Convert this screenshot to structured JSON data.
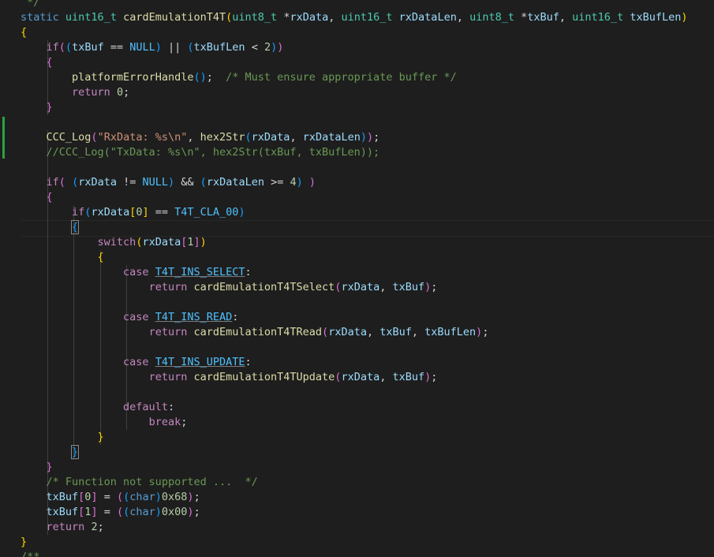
{
  "editor": {
    "language": "c",
    "lines": [
      [
        [
          "k-com",
          " */"
        ]
      ],
      [
        [
          "k-kw",
          "static"
        ],
        [
          "k-pun",
          " "
        ],
        [
          "k-typ",
          "uint16_t"
        ],
        [
          "k-pun",
          " "
        ],
        [
          "k-fn",
          "cardEmulationT4T"
        ],
        [
          "k-b1",
          "("
        ],
        [
          "k-typ",
          "uint8_t"
        ],
        [
          "k-pun",
          " *"
        ],
        [
          "k-var",
          "rxData"
        ],
        [
          "k-pun",
          ", "
        ],
        [
          "k-typ",
          "uint16_t"
        ],
        [
          "k-pun",
          " "
        ],
        [
          "k-var",
          "rxDataLen"
        ],
        [
          "k-pun",
          ", "
        ],
        [
          "k-typ",
          "uint8_t"
        ],
        [
          "k-pun",
          " *"
        ],
        [
          "k-var",
          "txBuf"
        ],
        [
          "k-pun",
          ", "
        ],
        [
          "k-typ",
          "uint16_t"
        ],
        [
          "k-pun",
          " "
        ],
        [
          "k-var",
          "txBufLen"
        ],
        [
          "k-b1",
          ")"
        ]
      ],
      [
        [
          "k-b1",
          "{"
        ]
      ],
      [
        [
          "k-pun",
          "    "
        ],
        [
          "k-ctl",
          "if"
        ],
        [
          "k-b2",
          "("
        ],
        [
          "k-b3",
          "("
        ],
        [
          "k-var",
          "txBuf"
        ],
        [
          "k-pun",
          " == "
        ],
        [
          "k-mac",
          "NULL"
        ],
        [
          "k-b3",
          ")"
        ],
        [
          "k-pun",
          " || "
        ],
        [
          "k-b3",
          "("
        ],
        [
          "k-var",
          "txBufLen"
        ],
        [
          "k-pun",
          " < "
        ],
        [
          "k-num",
          "2"
        ],
        [
          "k-b3",
          ")"
        ],
        [
          "k-b2",
          ")"
        ]
      ],
      [
        [
          "k-pun",
          "    "
        ],
        [
          "k-b2",
          "{"
        ]
      ],
      [
        [
          "k-pun",
          "        "
        ],
        [
          "k-fn",
          "platformErrorHandle"
        ],
        [
          "k-b3",
          "()"
        ],
        [
          "k-pun",
          ";  "
        ],
        [
          "k-com",
          "/* Must ensure appropriate buffer */"
        ]
      ],
      [
        [
          "k-pun",
          "        "
        ],
        [
          "k-ctl",
          "return"
        ],
        [
          "k-pun",
          " "
        ],
        [
          "k-num",
          "0"
        ],
        [
          "k-pun",
          ";"
        ]
      ],
      [
        [
          "k-pun",
          "    "
        ],
        [
          "k-b2",
          "}"
        ]
      ],
      [],
      [
        [
          "k-pun",
          "    "
        ],
        [
          "k-fn",
          "CCC_Log"
        ],
        [
          "k-b2",
          "("
        ],
        [
          "k-str",
          "\"RxData: %s\\n\""
        ],
        [
          "k-pun",
          ", "
        ],
        [
          "k-fn",
          "hex2Str"
        ],
        [
          "k-b3",
          "("
        ],
        [
          "k-var",
          "rxData"
        ],
        [
          "k-pun",
          ", "
        ],
        [
          "k-var",
          "rxDataLen"
        ],
        [
          "k-b3",
          ")"
        ],
        [
          "k-b2",
          ")"
        ],
        [
          "k-pun",
          ";"
        ]
      ],
      [
        [
          "k-pun",
          "    "
        ],
        [
          "k-com",
          "//CCC_Log(\"TxData: %s\\n\", hex2Str(txBuf, txBufLen));"
        ]
      ],
      [],
      [
        [
          "k-pun",
          "    "
        ],
        [
          "k-ctl",
          "if"
        ],
        [
          "k-b2",
          "("
        ],
        [
          "k-pun",
          " "
        ],
        [
          "k-b3",
          "("
        ],
        [
          "k-var",
          "rxData"
        ],
        [
          "k-pun",
          " != "
        ],
        [
          "k-mac",
          "NULL"
        ],
        [
          "k-b3",
          ")"
        ],
        [
          "k-pun",
          " && "
        ],
        [
          "k-b3",
          "("
        ],
        [
          "k-var",
          "rxDataLen"
        ],
        [
          "k-pun",
          " >= "
        ],
        [
          "k-num",
          "4"
        ],
        [
          "k-b3",
          ")"
        ],
        [
          "k-pun",
          " "
        ],
        [
          "k-b2",
          ")"
        ]
      ],
      [
        [
          "k-pun",
          "    "
        ],
        [
          "k-b2",
          "{"
        ]
      ],
      [
        [
          "k-pun",
          "        "
        ],
        [
          "k-ctl",
          "if"
        ],
        [
          "k-b3",
          "("
        ],
        [
          "k-var",
          "rxData"
        ],
        [
          "k-b1",
          "["
        ],
        [
          "k-num",
          "0"
        ],
        [
          "k-b1",
          "]"
        ],
        [
          "k-pun",
          " == "
        ],
        [
          "k-mac",
          "T4T_CLA_00"
        ],
        [
          "k-b3",
          ")"
        ]
      ],
      [
        [
          "k-pun",
          "        "
        ],
        [
          "k-b3 k-bm",
          "{"
        ]
      ],
      [
        [
          "k-pun",
          "            "
        ],
        [
          "k-ctl",
          "switch"
        ],
        [
          "k-b1",
          "("
        ],
        [
          "k-var",
          "rxData"
        ],
        [
          "k-b2",
          "["
        ],
        [
          "k-num",
          "1"
        ],
        [
          "k-b2",
          "]"
        ],
        [
          "k-b1",
          ")"
        ]
      ],
      [
        [
          "k-pun",
          "            "
        ],
        [
          "k-b1",
          "{"
        ]
      ],
      [
        [
          "k-pun",
          "                "
        ],
        [
          "k-ctl",
          "case"
        ],
        [
          "k-pun",
          " "
        ],
        [
          "k-mac k-ul",
          "T4T_INS_SELECT"
        ],
        [
          "k-pun",
          ":"
        ]
      ],
      [
        [
          "k-pun",
          "                    "
        ],
        [
          "k-ctl",
          "return"
        ],
        [
          "k-pun",
          " "
        ],
        [
          "k-fn",
          "cardEmulationT4TSelect"
        ],
        [
          "k-b2",
          "("
        ],
        [
          "k-var",
          "rxData"
        ],
        [
          "k-pun",
          ", "
        ],
        [
          "k-var",
          "txBuf"
        ],
        [
          "k-b2",
          ")"
        ],
        [
          "k-pun",
          ";"
        ]
      ],
      [],
      [
        [
          "k-pun",
          "                "
        ],
        [
          "k-ctl",
          "case"
        ],
        [
          "k-pun",
          " "
        ],
        [
          "k-mac k-ul",
          "T4T_INS_READ"
        ],
        [
          "k-pun",
          ":"
        ]
      ],
      [
        [
          "k-pun",
          "                    "
        ],
        [
          "k-ctl",
          "return"
        ],
        [
          "k-pun",
          " "
        ],
        [
          "k-fn",
          "cardEmulationT4TRead"
        ],
        [
          "k-b2",
          "("
        ],
        [
          "k-var",
          "rxData"
        ],
        [
          "k-pun",
          ", "
        ],
        [
          "k-var",
          "txBuf"
        ],
        [
          "k-pun",
          ", "
        ],
        [
          "k-var",
          "txBufLen"
        ],
        [
          "k-b2",
          ")"
        ],
        [
          "k-pun",
          ";"
        ]
      ],
      [],
      [
        [
          "k-pun",
          "                "
        ],
        [
          "k-ctl",
          "case"
        ],
        [
          "k-pun",
          " "
        ],
        [
          "k-mac k-ul",
          "T4T_INS_UPDATE"
        ],
        [
          "k-pun",
          ":"
        ]
      ],
      [
        [
          "k-pun",
          "                    "
        ],
        [
          "k-ctl",
          "return"
        ],
        [
          "k-pun",
          " "
        ],
        [
          "k-fn",
          "cardEmulationT4TUpdate"
        ],
        [
          "k-b2",
          "("
        ],
        [
          "k-var",
          "rxData"
        ],
        [
          "k-pun",
          ", "
        ],
        [
          "k-var",
          "txBuf"
        ],
        [
          "k-b2",
          ")"
        ],
        [
          "k-pun",
          ";"
        ]
      ],
      [],
      [
        [
          "k-pun",
          "                "
        ],
        [
          "k-ctl",
          "default"
        ],
        [
          "k-pun",
          ":"
        ]
      ],
      [
        [
          "k-pun",
          "                    "
        ],
        [
          "k-ctl",
          "break"
        ],
        [
          "k-pun",
          ";"
        ]
      ],
      [
        [
          "k-pun",
          "            "
        ],
        [
          "k-b1",
          "}"
        ]
      ],
      [
        [
          "k-pun",
          "        "
        ],
        [
          "k-b3 k-bm",
          "}"
        ]
      ],
      [
        [
          "k-pun",
          "    "
        ],
        [
          "k-b2",
          "}"
        ]
      ],
      [
        [
          "k-pun",
          "    "
        ],
        [
          "k-com",
          "/* Function not supported ...  */"
        ]
      ],
      [
        [
          "k-pun",
          "    "
        ],
        [
          "k-var",
          "txBuf"
        ],
        [
          "k-b2",
          "["
        ],
        [
          "k-num",
          "0"
        ],
        [
          "k-b2",
          "]"
        ],
        [
          "k-pun",
          " = "
        ],
        [
          "k-b2",
          "("
        ],
        [
          "k-b3",
          "("
        ],
        [
          "k-kw",
          "char"
        ],
        [
          "k-b3",
          ")"
        ],
        [
          "k-num",
          "0x68"
        ],
        [
          "k-b2",
          ")"
        ],
        [
          "k-pun",
          ";"
        ]
      ],
      [
        [
          "k-pun",
          "    "
        ],
        [
          "k-var",
          "txBuf"
        ],
        [
          "k-b2",
          "["
        ],
        [
          "k-num",
          "1"
        ],
        [
          "k-b2",
          "]"
        ],
        [
          "k-pun",
          " = "
        ],
        [
          "k-b2",
          "("
        ],
        [
          "k-b3",
          "("
        ],
        [
          "k-kw",
          "char"
        ],
        [
          "k-b3",
          ")"
        ],
        [
          "k-num",
          "0x00"
        ],
        [
          "k-b2",
          ")"
        ],
        [
          "k-pun",
          ";"
        ]
      ],
      [
        [
          "k-pun",
          "    "
        ],
        [
          "k-ctl",
          "return"
        ],
        [
          "k-pun",
          " "
        ],
        [
          "k-num",
          "2"
        ],
        [
          "k-pun",
          ";"
        ]
      ],
      [
        [
          "k-b1",
          "}"
        ]
      ],
      [
        [
          "k-com",
          "/**"
        ]
      ]
    ]
  }
}
